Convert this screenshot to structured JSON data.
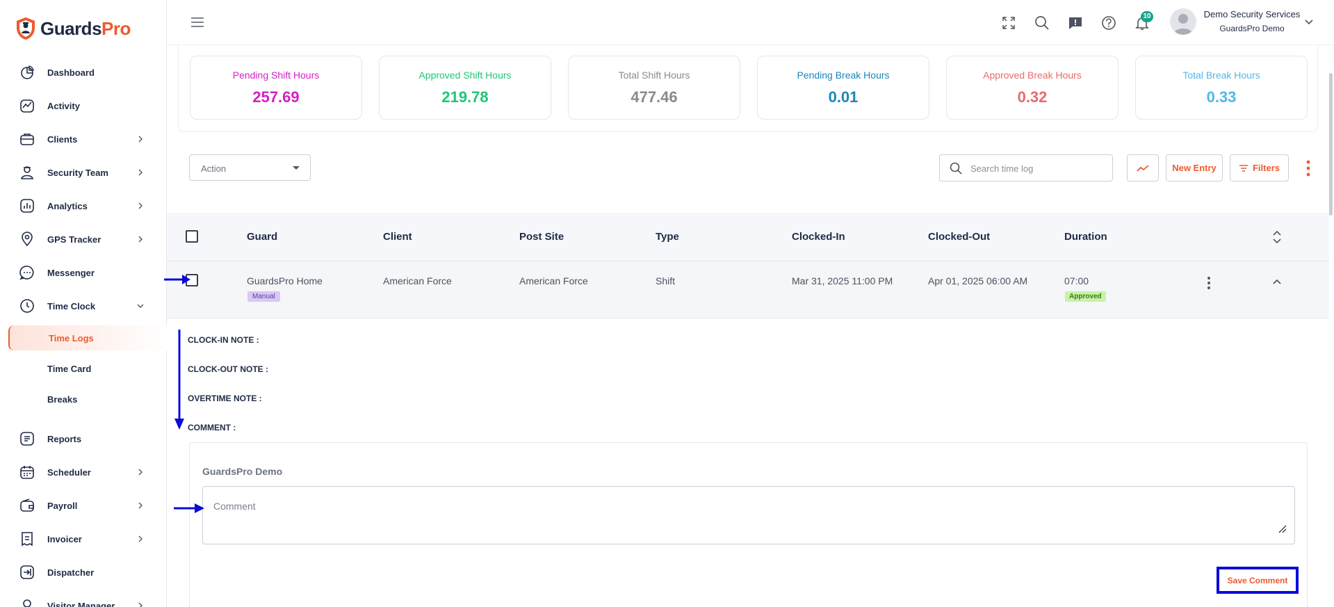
{
  "app": {
    "brand_left": "Guards",
    "brand_right": "Pro",
    "accent_color": "#ee5a2f"
  },
  "sidebar": {
    "items": [
      {
        "label": "Dashboard",
        "icon": "dashboard-icon"
      },
      {
        "label": "Activity",
        "icon": "activity-icon"
      },
      {
        "label": "Clients",
        "icon": "clients-icon"
      },
      {
        "label": "Security Team",
        "icon": "security-team-icon"
      },
      {
        "label": "Analytics",
        "icon": "analytics-icon"
      },
      {
        "label": "GPS Tracker",
        "icon": "gps-pin-icon"
      },
      {
        "label": "Messenger",
        "icon": "chat-icon"
      },
      {
        "label": "Time Clock",
        "icon": "clock-icon"
      },
      {
        "label": "Reports",
        "icon": "reports-icon"
      },
      {
        "label": "Scheduler",
        "icon": "calendar-icon"
      },
      {
        "label": "Payroll",
        "icon": "wallet-icon"
      },
      {
        "label": "Invoicer",
        "icon": "invoice-icon"
      },
      {
        "label": "Dispatcher",
        "icon": "dispatch-icon"
      },
      {
        "label": "Visitor Manager",
        "icon": "visitor-icon"
      }
    ],
    "time_clock_sub": [
      {
        "label": "Time Logs",
        "active": true
      },
      {
        "label": "Time Card",
        "active": false
      },
      {
        "label": "Breaks",
        "active": false
      }
    ]
  },
  "header": {
    "notification_count": "10",
    "user_name": "Demo Security Services",
    "user_org": "GuardsPro Demo"
  },
  "stats": [
    {
      "title": "Pending Shift Hours",
      "value": "257.69",
      "color": "#d61ec7"
    },
    {
      "title": "Approved Shift Hours",
      "value": "219.78",
      "color": "#1ec776"
    },
    {
      "title": "Total Shift Hours",
      "value": "477.46",
      "color": "#8a8a8a"
    },
    {
      "title": "Pending Break Hours",
      "value": "0.01",
      "color": "#1a86b8"
    },
    {
      "title": "Approved Break Hours",
      "value": "0.32",
      "color": "#e86a6a"
    },
    {
      "title": "Total Break Hours",
      "value": "0.33",
      "color": "#4fb8e6"
    }
  ],
  "toolbar": {
    "action_label": "Action",
    "search_placeholder": "Search time log",
    "new_entry_label": "New Entry",
    "filters_label": "Filters"
  },
  "table": {
    "columns": [
      "Guard",
      "Client",
      "Post Site",
      "Type",
      "Clocked-In",
      "Clocked-Out",
      "Duration"
    ],
    "rows": [
      {
        "guard": "GuardsPro Home",
        "guard_tag": "Manual",
        "client": "American Force",
        "post_site": "American Force",
        "type": "Shift",
        "clocked_in": "Mar 31, 2025 11:00 PM",
        "clocked_out": "Apr 01, 2025 06:00 AM",
        "duration": "07:00",
        "status": "Approved"
      }
    ]
  },
  "details": {
    "clock_in_note": "CLOCK-IN NOTE :",
    "clock_out_note": "CLOCK-OUT NOTE :",
    "overtime_note": "OVERTIME NOTE :",
    "comment": "COMMENT :",
    "author": "GuardsPro Demo",
    "comment_placeholder": "Comment",
    "save_label": "Save Comment"
  }
}
